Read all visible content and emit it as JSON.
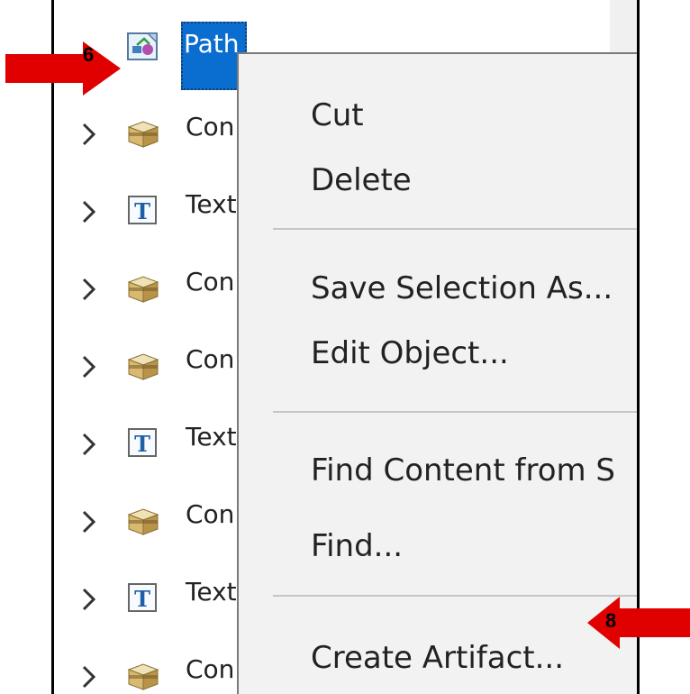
{
  "tree": {
    "selected_label": "Path",
    "items": [
      {
        "label": "Con",
        "icon": "container-icon"
      },
      {
        "label": "Text",
        "icon": "text-t-icon"
      },
      {
        "label": "Con",
        "icon": "container-icon"
      },
      {
        "label": "Con",
        "icon": "container-icon"
      },
      {
        "label": "Text",
        "icon": "text-t-icon"
      },
      {
        "label": "Con",
        "icon": "container-icon"
      },
      {
        "label": "Text",
        "icon": "text-t-icon"
      },
      {
        "label": "Con",
        "icon": "container-icon"
      }
    ]
  },
  "context_menu": {
    "cut": "Cut",
    "delete": "Delete",
    "save_selection_as": "Save Selection As...",
    "edit_object": "Edit Object...",
    "find_content_from": "Find Content from S",
    "find": "Find...",
    "create_artifact": "Create Artifact..."
  },
  "callouts": {
    "left_number": "6",
    "right_number": "8"
  },
  "colors": {
    "selection": "#0a6ed1",
    "callout_arrow": "#e00000",
    "menu_background": "#f2f2f2"
  }
}
